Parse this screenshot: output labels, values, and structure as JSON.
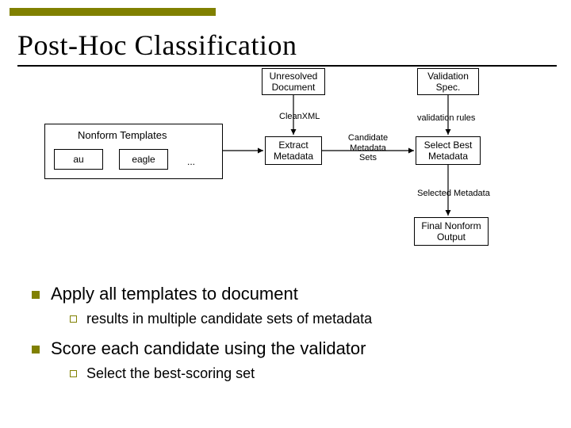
{
  "title": "Post-Hoc Classification",
  "diagram": {
    "nonform_group_label": "Nonform Templates",
    "template_a": "au",
    "template_b": "eagle",
    "ellipsis": "...",
    "unresolved": "Unresolved\nDocument",
    "cleanxml": "CleanXML",
    "extract": "Extract\nMetadata",
    "candidate": "Candidate\nMetadata\nSets",
    "validation_spec": "Validation\nSpec.",
    "validation_rules": "validation rules",
    "select_best": "Select Best\nMetadata",
    "selected_meta": "Selected Metadata",
    "final_output": "Final Nonform\nOutput"
  },
  "bullets": {
    "b1": "Apply all templates to document",
    "b1a": "results in multiple candidate sets of metadata",
    "b2": "Score each candidate using the validator",
    "b2a": "Select the best-scoring set"
  }
}
